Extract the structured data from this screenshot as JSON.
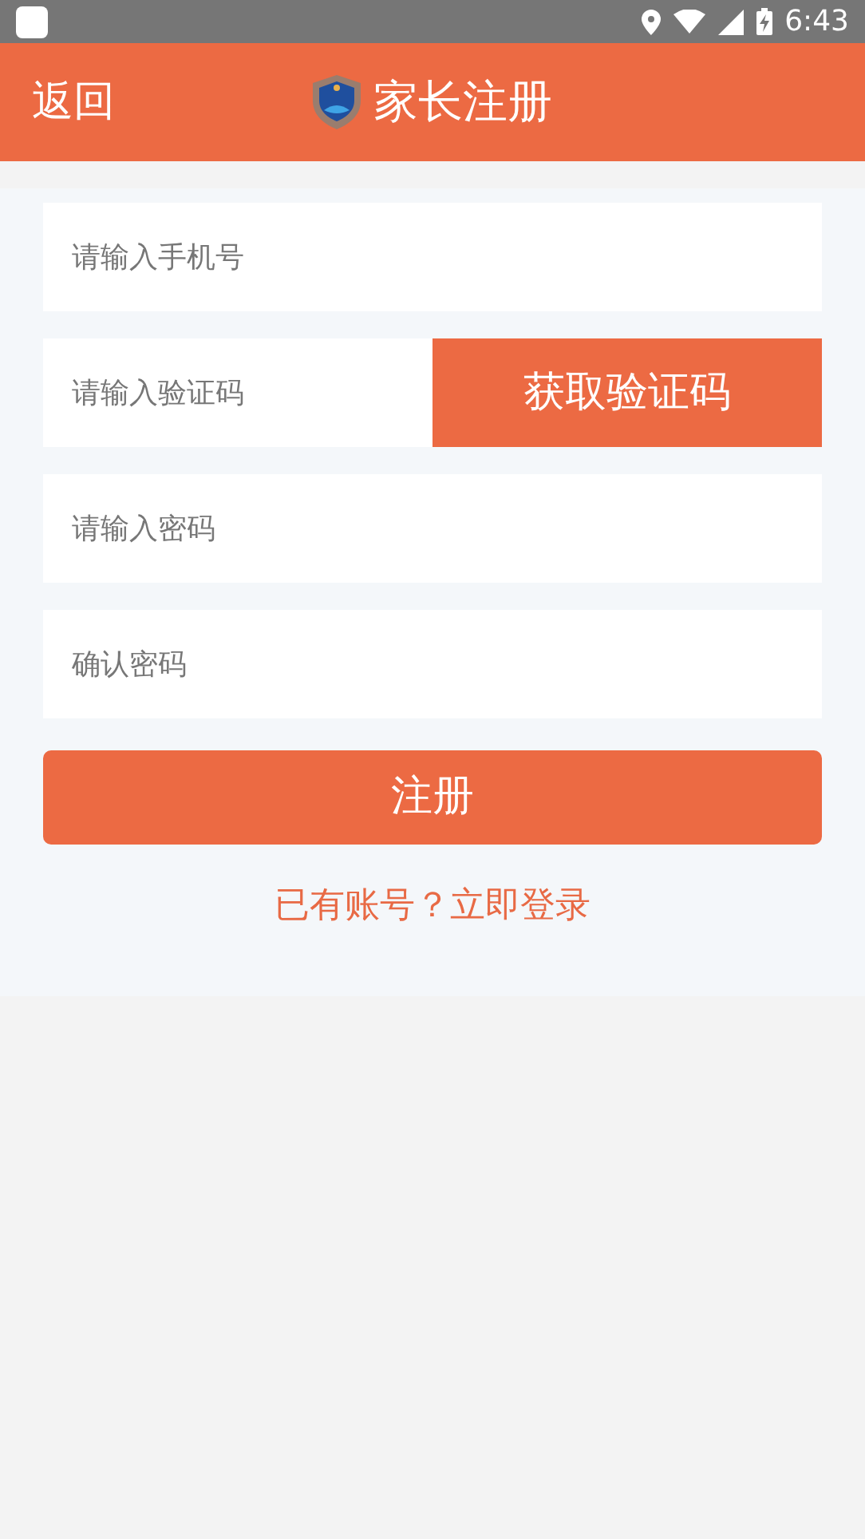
{
  "status_bar": {
    "time": "6:43"
  },
  "header": {
    "back": "返回",
    "title": "家长注册"
  },
  "fields": [
    {
      "placeholder": "请输入手机号"
    },
    {
      "placeholder": "请输入验证码",
      "button": "获取验证码"
    },
    {
      "placeholder": "请输入密码"
    },
    {
      "placeholder": "确认密码"
    }
  ],
  "register_button": "注册",
  "login_link": "已有账号？立即登录"
}
